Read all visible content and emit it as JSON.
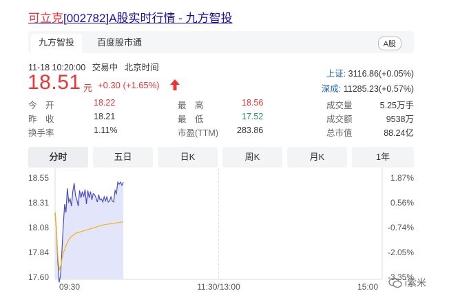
{
  "title": {
    "name": "可立克",
    "code": "[002782]",
    "rest": "A股实时行情 - 九方智投"
  },
  "tabs": [
    {
      "label": "九方智投",
      "active": true
    },
    {
      "label": "百度股市通",
      "active": false
    }
  ],
  "market_badge": "A股",
  "meta": {
    "datetime": "11-18 10:20:00",
    "status": "交易中",
    "timezone": "北京时间"
  },
  "quote": {
    "price": "18.51",
    "unit": "元",
    "change": "+0.30 (+1.65%)"
  },
  "indices": [
    {
      "label": "上证:",
      "value": "3116.86(+0.05%)"
    },
    {
      "label": "深成:",
      "value": "11285.23(+0.57%)"
    }
  ],
  "stats": {
    "open": {
      "label": "今　开",
      "value": "18.22"
    },
    "prev_close": {
      "label": "昨　收",
      "value": "18.21"
    },
    "turnover_rate": {
      "label": "换手率",
      "value": "1.11%"
    },
    "high": {
      "label": "最　高",
      "value": "18.56"
    },
    "low": {
      "label": "最　低",
      "value": "17.52"
    },
    "pe_ttm": {
      "label": "市盈(TTM)",
      "value": "283.86"
    },
    "volume": {
      "label": "成交量",
      "value": "5.25万手"
    },
    "amount": {
      "label": "成交额",
      "value": "9538万"
    },
    "market_cap": {
      "label": "总市值",
      "value": "88.24亿"
    }
  },
  "periods": [
    {
      "label": "分时",
      "active": true
    },
    {
      "label": "五日",
      "active": false
    },
    {
      "label": "日K",
      "active": false
    },
    {
      "label": "周K",
      "active": false
    },
    {
      "label": "月K",
      "active": false
    },
    {
      "label": "1年",
      "active": false
    }
  ],
  "watermark": "i紫米",
  "colors": {
    "up": "#e33333",
    "down": "#1a9a5a",
    "price_line": "#4b4bc8",
    "avg_line": "#f5b400",
    "link": "#1a0dab"
  },
  "chart_data": {
    "type": "line",
    "title": "",
    "xlabel": "",
    "ylabel": "",
    "ylim": [
      17.6,
      18.55
    ],
    "y_ticks": [
      "18.55",
      "18.31",
      "18.08",
      "17.84",
      "17.60"
    ],
    "y_right_ticks": [
      "1.87%",
      "0.56%",
      "-0.74%",
      "-2.05%",
      "-3.35%"
    ],
    "x_ticks": [
      "09:30",
      "11:30/13:00",
      "15:00"
    ],
    "x_range_minutes": [
      0,
      240
    ],
    "series": [
      {
        "name": "",
        "x": [
          0,
          1,
          2,
          3,
          4,
          5,
          6,
          7,
          8,
          9,
          10,
          11,
          12,
          13,
          14,
          15,
          16,
          17,
          18,
          19,
          20,
          21,
          22,
          23,
          24,
          25,
          26,
          27,
          28,
          29,
          30,
          31,
          32,
          33,
          34,
          35,
          36,
          37,
          38,
          39,
          40,
          41,
          42,
          43,
          44,
          45,
          46,
          47,
          48,
          49,
          50
        ],
        "values": [
          18.22,
          18.05,
          17.75,
          17.55,
          17.62,
          17.85,
          18.1,
          18.3,
          18.22,
          18.45,
          18.32,
          18.35,
          18.28,
          18.42,
          18.5,
          18.38,
          18.34,
          18.28,
          18.43,
          18.36,
          18.42,
          18.37,
          18.44,
          18.3,
          18.43,
          18.36,
          18.42,
          18.34,
          18.4,
          18.39,
          18.36,
          18.32,
          18.39,
          18.34,
          18.35,
          18.32,
          18.37,
          18.33,
          18.37,
          18.32,
          18.33,
          18.37,
          18.33,
          18.32,
          18.43,
          18.4,
          18.51,
          18.49,
          18.51,
          18.48,
          18.51
        ]
      },
      {
        "name": "",
        "x": [
          0,
          1,
          2,
          3,
          4,
          5,
          6,
          8,
          10,
          12,
          15,
          20,
          25,
          30,
          35,
          40,
          45,
          50
        ],
        "values": [
          18.22,
          18.05,
          17.8,
          17.67,
          17.7,
          17.77,
          17.83,
          17.9,
          17.96,
          17.99,
          18.02,
          18.04,
          18.06,
          18.08,
          18.1,
          18.11,
          18.12,
          18.13
        ]
      }
    ]
  }
}
